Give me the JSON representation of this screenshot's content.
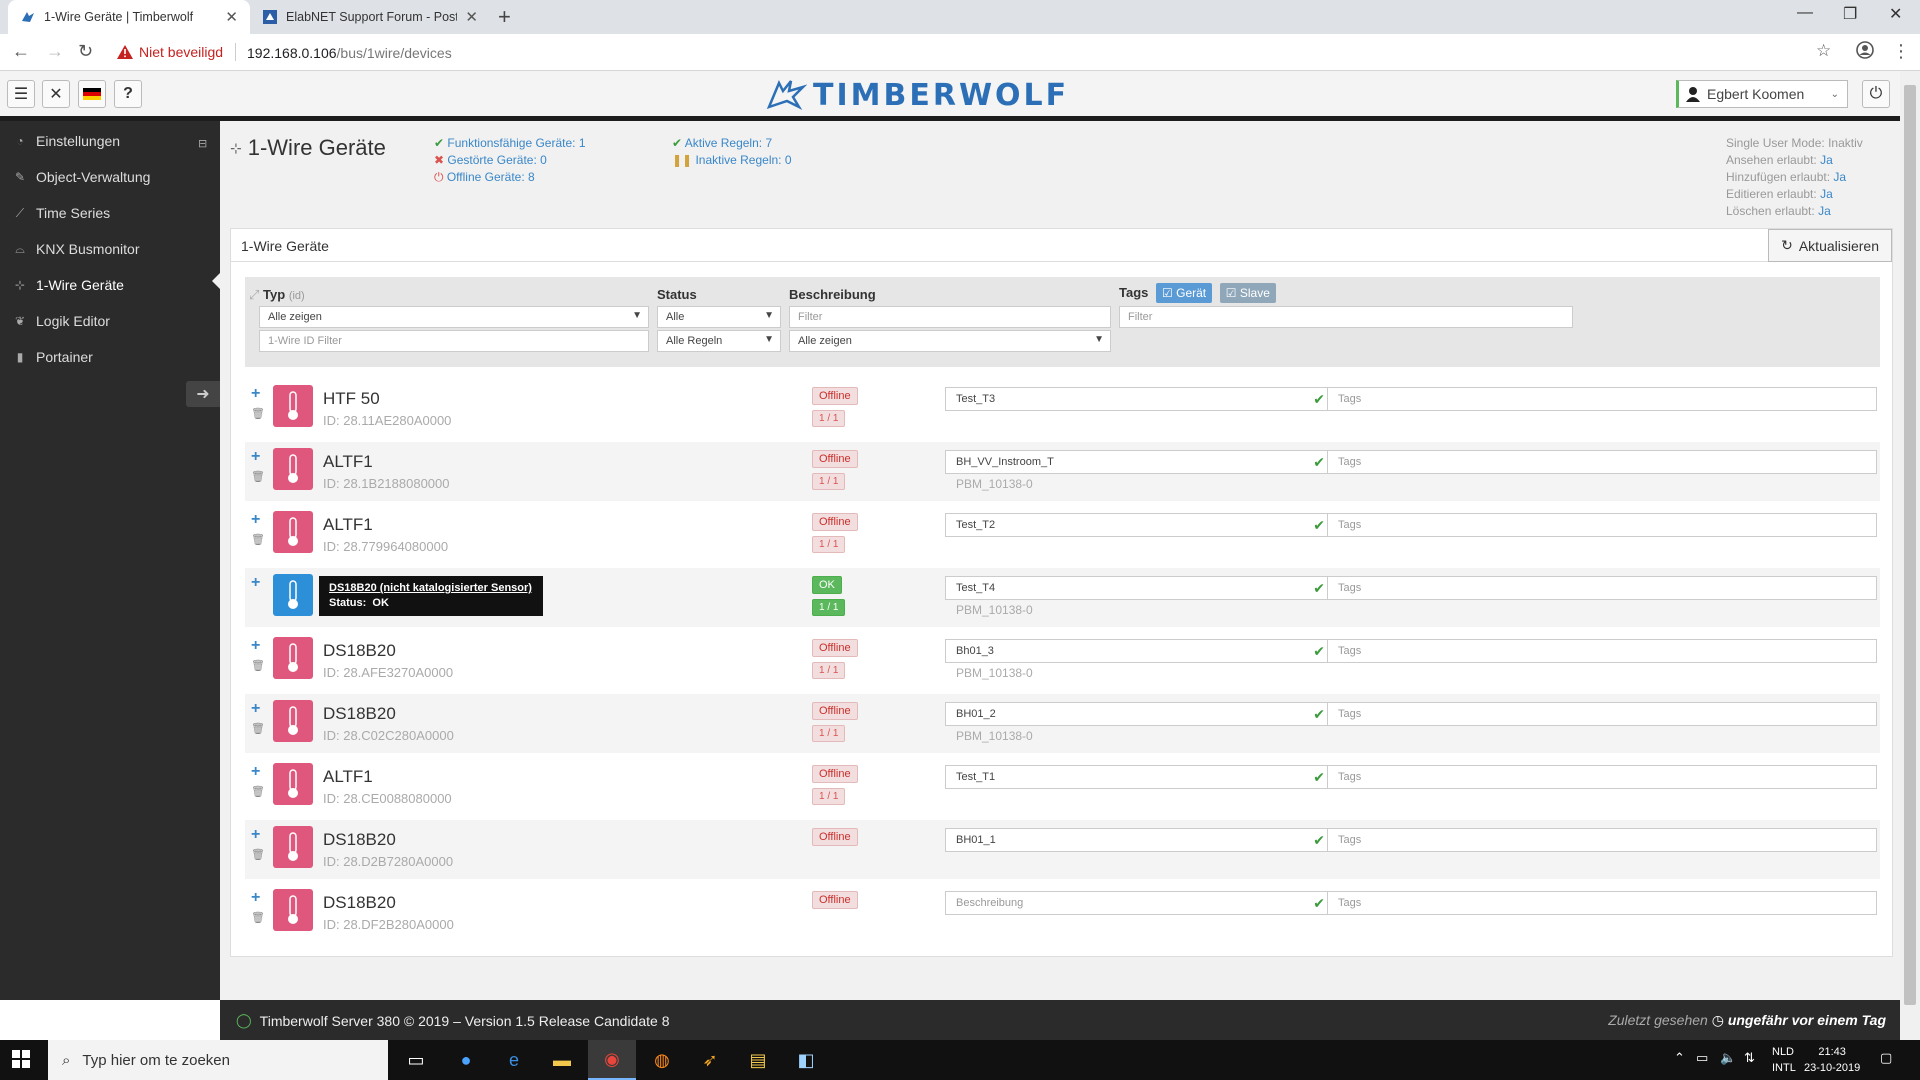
{
  "browser": {
    "tabs": [
      {
        "title": "1-Wire Geräte | Timberwolf",
        "active": true
      },
      {
        "title": "ElabNET Support Forum - Post a",
        "active": false
      }
    ],
    "security_label": "Niet beveiligd",
    "url_host": "192.168.0.106",
    "url_path": "/bus/1wire/devices"
  },
  "header": {
    "logo_text": "TIMBERWOLF",
    "user": "Egbert Koomen"
  },
  "sidebar": {
    "items": [
      {
        "label": "Einstellungen"
      },
      {
        "label": "Object-Verwaltung"
      },
      {
        "label": "Time Series"
      },
      {
        "label": "KNX Busmonitor"
      },
      {
        "label": "1-Wire Geräte"
      },
      {
        "label": "Logik Editor"
      },
      {
        "label": "Portainer"
      }
    ]
  },
  "page": {
    "title": "1-Wire Geräte",
    "summary": {
      "functional": "Funktionsfähige Geräte: 1",
      "faulty": "Gestörte Geräte: 0",
      "offline": "Offline Geräte: 8",
      "active_rules": "Aktive Regeln: 7",
      "inactive_rules": "Inaktive Regeln: 0"
    },
    "permissions": {
      "single_user_label": "Single User Mode:",
      "single_user_value": "Inaktiv",
      "view_label": "Ansehen erlaubt:",
      "view_value": "Ja",
      "add_label": "Hinzufügen erlaubt:",
      "add_value": "Ja",
      "edit_label": "Editieren erlaubt:",
      "edit_value": "Ja",
      "delete_label": "Löschen erlaubt:",
      "delete_value": "Ja"
    }
  },
  "panel": {
    "title": "1-Wire Geräte",
    "refresh_label": "Aktualisieren"
  },
  "filters": {
    "col_typ": "Typ",
    "col_typ_sub": "(id)",
    "col_status": "Status",
    "col_desc": "Beschreibung",
    "col_tags": "Tags",
    "tag_geraet": "Gerät",
    "tag_slave": "Slave",
    "typ_select": "Alle zeigen",
    "id_filter_placeholder": "1-Wire ID Filter",
    "status_select": "Alle",
    "rules_select": "Alle Regeln",
    "desc_filter_placeholder": "Filter",
    "desc_select": "Alle zeigen",
    "tags_filter_placeholder": "Filter"
  },
  "devices": [
    {
      "name": "HTF 50",
      "id": "ID: 28.11AE280A0000",
      "status": "Offline",
      "rules": "1 / 1",
      "desc": "Test_T3",
      "sub": "",
      "tags": "Tags"
    },
    {
      "name": "ALTF1",
      "id": "ID: 28.1B2188080000",
      "status": "Offline",
      "rules": "1 / 1",
      "desc": "BH_VV_Instroom_T",
      "sub": "PBM_10138-0",
      "tags": "Tags"
    },
    {
      "name": "ALTF1",
      "id": "ID: 28.779964080000",
      "status": "Offline",
      "rules": "1 / 1",
      "desc": "Test_T2",
      "sub": "",
      "tags": "Tags"
    },
    {
      "name": "DS18B20 (nicht katalogisierter Sensor)",
      "id": "Status:",
      "status_value": "OK",
      "status": "OK",
      "rules": "1 / 1",
      "desc": "Test_T4",
      "sub": "PBM_10138-0",
      "tags": "Tags"
    },
    {
      "name": "DS18B20",
      "id": "ID: 28.AFE3270A0000",
      "status": "Offline",
      "rules": "1 / 1",
      "desc": "Bh01_3",
      "sub": "PBM_10138-0",
      "tags": "Tags"
    },
    {
      "name": "DS18B20",
      "id": "ID: 28.C02C280A0000",
      "status": "Offline",
      "rules": "1 / 1",
      "desc": "BH01_2",
      "sub": "PBM_10138-0",
      "tags": "Tags"
    },
    {
      "name": "ALTF1",
      "id": "ID: 28.CE0088080000",
      "status": "Offline",
      "rules": "1 / 1",
      "desc": "Test_T1",
      "sub": "",
      "tags": "Tags"
    },
    {
      "name": "DS18B20",
      "id": "ID: 28.D2B7280A0000",
      "status": "Offline",
      "rules": "",
      "desc": "BH01_1",
      "sub": "",
      "tags": "Tags"
    },
    {
      "name": "DS18B20",
      "id": "ID: 28.DF2B280A0000",
      "status": "Offline",
      "rules": "",
      "desc": "Beschreibung",
      "sub": "",
      "tags": "Tags"
    }
  ],
  "footer": {
    "left": "Timberwolf Server 380 © 2019 – Version 1.5 Release Candidate 8",
    "right_label": "Zuletzt gesehen",
    "right_value": "ungefähr vor einem Tag"
  },
  "taskbar": {
    "search_placeholder": "Typ hier om te zoeken",
    "lang_top": "NLD",
    "lang_bottom": "INTL",
    "time": "21:43",
    "date": "23-10-2019"
  },
  "colors": {
    "sidebar_bg": "#2b2b2b",
    "accent_blue": "#3a87c8",
    "offline_red": "#d9534f",
    "ok_green": "#5cb85c",
    "sensor_pink": "#e0577e",
    "sensor_blue": "#2e8fd9"
  }
}
